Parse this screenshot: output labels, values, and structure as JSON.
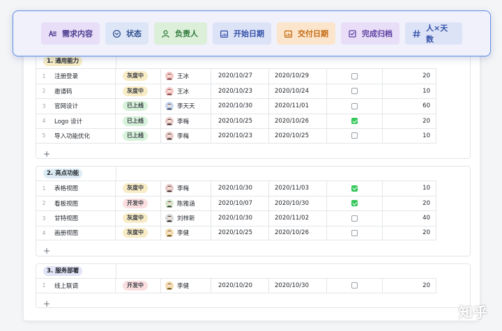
{
  "toolbar": {
    "fields": [
      {
        "label": "需求内容",
        "icon": "text-icon",
        "bg": "#e8def8",
        "color": "#4c3d8f"
      },
      {
        "label": "状态",
        "icon": "status-circle-icon",
        "bg": "#dde6f7",
        "color": "#2f4f8f"
      },
      {
        "label": "负责人",
        "icon": "person-icon",
        "bg": "#dcefd9",
        "color": "#2f7a3b"
      },
      {
        "label": "开始日期",
        "icon": "calendar-icon",
        "bg": "#dde3f7",
        "color": "#3450a8"
      },
      {
        "label": "交付日期",
        "icon": "calendar-icon",
        "bg": "#fbe5cc",
        "color": "#c46a12"
      },
      {
        "label": "完成归档",
        "icon": "checkbox-icon",
        "bg": "#e8def8",
        "color": "#5b3fa0"
      },
      {
        "label": "人×天数",
        "icon": "hash-icon",
        "bg": "#dde3f7",
        "color": "#3450a8"
      }
    ]
  },
  "groups": [
    {
      "title": "1. 通用能力",
      "tag_color": "#f7ecc5",
      "rows": [
        {
          "idx": "1",
          "name": "注册登录",
          "status": "灰度中",
          "status_kind": "gray",
          "owner": "王冰",
          "start": "2020/10/27",
          "end": "2020/10/29",
          "done": false,
          "days": "20"
        },
        {
          "idx": "2",
          "name": "邀请码",
          "status": "灰度中",
          "status_kind": "gray",
          "owner": "王冰",
          "start": "2020/10/23",
          "end": "2020/10/24",
          "done": false,
          "days": "10"
        },
        {
          "idx": "3",
          "name": "官网设计",
          "status": "已上线",
          "status_kind": "green",
          "owner": "李天天",
          "start": "2020/10/30",
          "end": "2020/11/01",
          "done": false,
          "days": "60"
        },
        {
          "idx": "4",
          "name": "Logo 设计",
          "status": "已上线",
          "status_kind": "green",
          "owner": "李梅",
          "start": "2020/10/25",
          "end": "2020/10/26",
          "done": true,
          "days": "20"
        },
        {
          "idx": "5",
          "name": "导入功能优化",
          "status": "已上线",
          "status_kind": "green",
          "owner": "李梅",
          "start": "2020/10/23",
          "end": "2020/10/25",
          "done": false,
          "days": "10"
        }
      ]
    },
    {
      "title": "2. 亮点功能",
      "tag_color": "#dcecf5",
      "rows": [
        {
          "idx": "1",
          "name": "表格视图",
          "status": "灰度中",
          "status_kind": "gray",
          "owner": "李梅",
          "start": "2020/10/30",
          "end": "2020/11/03",
          "done": true,
          "days": "10"
        },
        {
          "idx": "2",
          "name": "看板视图",
          "status": "开发中",
          "status_kind": "red",
          "owner": "陈雅涵",
          "start": "2020/10/07",
          "end": "2020/10/30",
          "done": true,
          "days": "20"
        },
        {
          "idx": "3",
          "name": "甘特视图",
          "status": "灰度中",
          "status_kind": "gray",
          "owner": "刘梓新",
          "start": "2020/10/30",
          "end": "2020/11/02",
          "done": false,
          "days": "40"
        },
        {
          "idx": "4",
          "name": "画册视图",
          "status": "灰度中",
          "status_kind": "gray",
          "owner": "李健",
          "start": "2020/10/25",
          "end": "2020/10/26",
          "done": false,
          "days": "20"
        }
      ]
    },
    {
      "title": "3. 服务部署",
      "tag_color": "#e2e4f7",
      "rows": [
        {
          "idx": "1",
          "name": "线上联调",
          "status": "开发中",
          "status_kind": "red",
          "owner": "李健",
          "start": "2020/10/20",
          "end": "2020/10/30",
          "done": false,
          "days": "20"
        }
      ]
    }
  ],
  "add_symbol": "+",
  "watermark": "知乎",
  "colors": {
    "accent": "#5b8ee6",
    "check_on": "#34c759"
  }
}
